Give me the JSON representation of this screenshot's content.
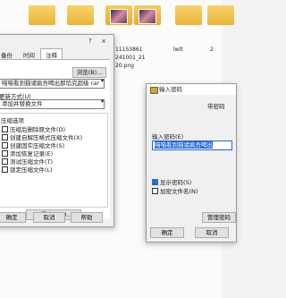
{
  "explorer": {
    "file_label_1": "11153861",
    "file_label_2": "241001_21",
    "file_label_3": "20.png",
    "folder_label_4": "lwlt",
    "file_label_5": "2"
  },
  "archive_dialog": {
    "help_glyph": "?",
    "close_glyph": "×",
    "tabs": [
      "备份",
      "时间",
      "注释"
    ],
    "browse_button": "浏览(B)...",
    "archive_name": "喵喵看到猫诸疯吾喝出那馅究超级 rar",
    "update_method_label": "更新方式(U)",
    "update_method_value": "添加并替换文件",
    "options_label": "压缩选项",
    "options": [
      {
        "label": "压缩后删除原文件(D)",
        "checked": false
      },
      {
        "label": "创建自解压格式压缩文件(X)",
        "checked": false
      },
      {
        "label": "创建固实压缩文件(S)",
        "checked": false
      },
      {
        "label": "添加恢复记录(E)",
        "checked": false
      },
      {
        "label": "测试压缩文件(T)",
        "checked": false
      },
      {
        "label": "锁定压缩文件(L)",
        "checked": false
      }
    ],
    "set_password_button": "设置密码(P)...",
    "ok_button": "确定",
    "cancel_button": "取消",
    "help_button": "帮助"
  },
  "password_dialog": {
    "title": "输入密码",
    "header_text": "带密码",
    "prompt_label": "输入密码(E)",
    "password_value": "喵喵看到猫诸疯吾喝出",
    "options": [
      {
        "label": "显示密码(S)",
        "checked": true
      },
      {
        "label": "加密文件名(N)",
        "checked": false
      }
    ],
    "manage_button": "管理密码",
    "ok_button": "确定",
    "cancel_button": "取消"
  },
  "colors": {
    "accent": "#1e67d2",
    "dialog_bg": "#f0f0f0"
  }
}
